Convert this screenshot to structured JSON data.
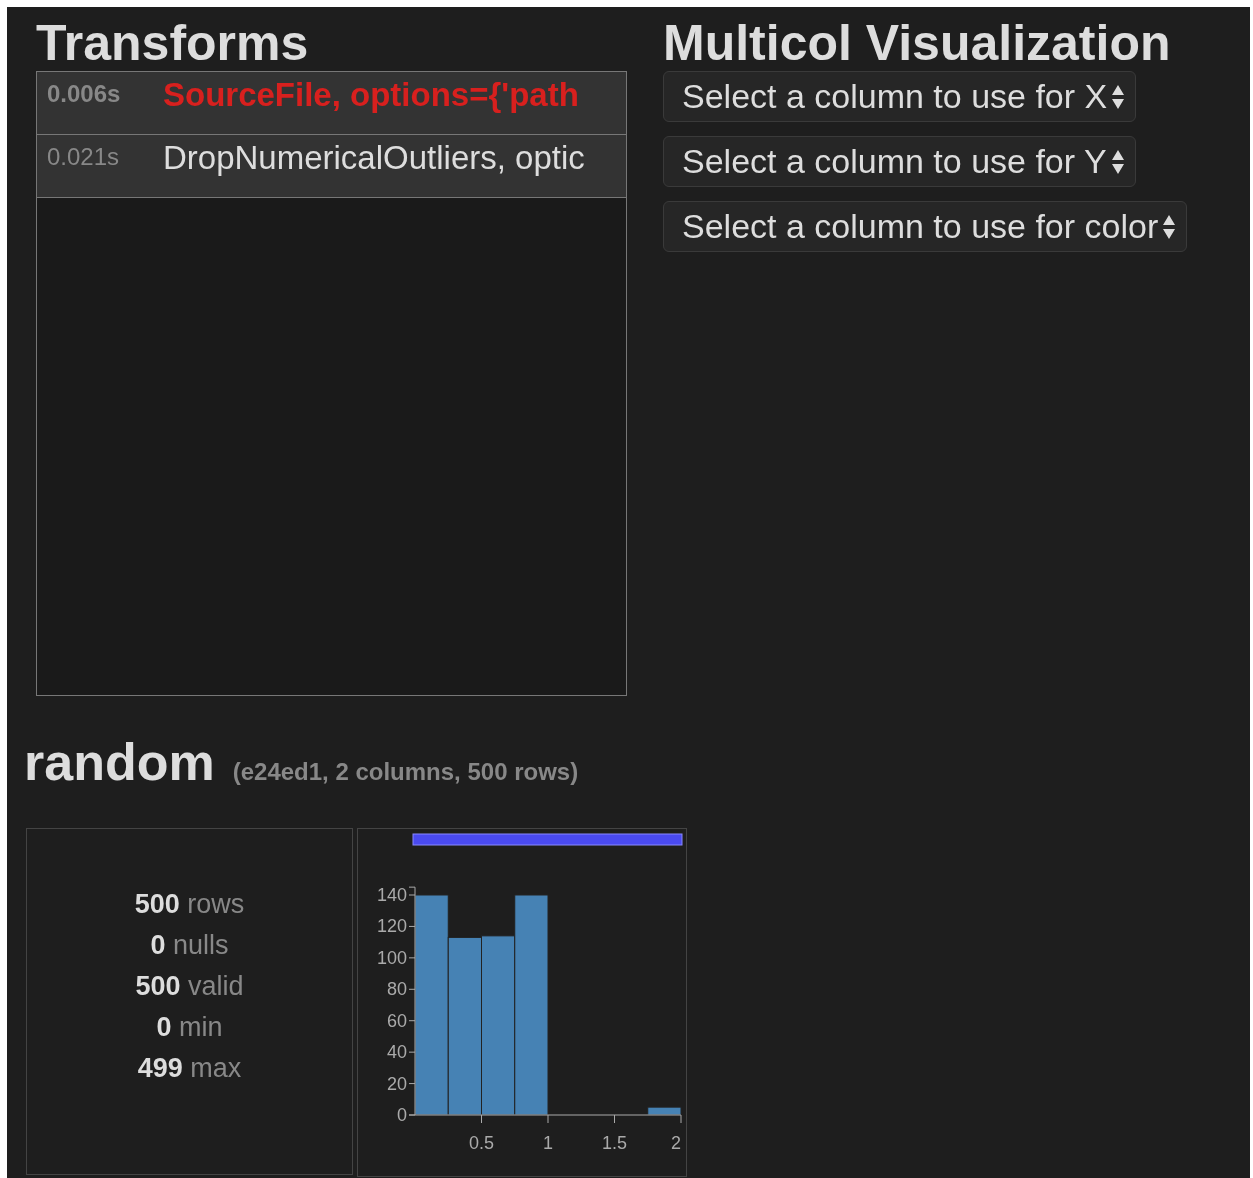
{
  "transforms": {
    "title": "Transforms",
    "rows": [
      {
        "time": "0.006s",
        "label": "SourceFile, options={'path",
        "selected": true
      },
      {
        "time": "0.021s",
        "label": "DropNumericalOutliers, optic",
        "selected": false
      }
    ]
  },
  "visualization": {
    "title": "Multicol Visualization",
    "selects": [
      "Select a column to use for X",
      "Select a column to use for Y",
      "Select a column to use for color"
    ]
  },
  "dataset": {
    "name": "random",
    "info": "(e24ed1, 2 columns, 500 rows)",
    "stats": [
      "**500** rows",
      "**0** nulls",
      "**500** valid",
      "**0** min",
      "**499** max"
    ],
    "histogram": {
      "chart_data": {
        "type": "bar",
        "x": [
          0.125,
          0.375,
          0.625,
          0.875,
          1.125,
          1.375,
          1.625,
          1.875
        ],
        "values": [
          140,
          113,
          114,
          140,
          0,
          0,
          0,
          5
        ],
        "xlim": [
          0,
          2
        ],
        "ylim": [
          0,
          145
        ],
        "xticks": [
          0.5,
          1,
          1.5,
          2
        ],
        "yticks": [
          0,
          20,
          40,
          60,
          80,
          100,
          120,
          140
        ]
      }
    }
  }
}
